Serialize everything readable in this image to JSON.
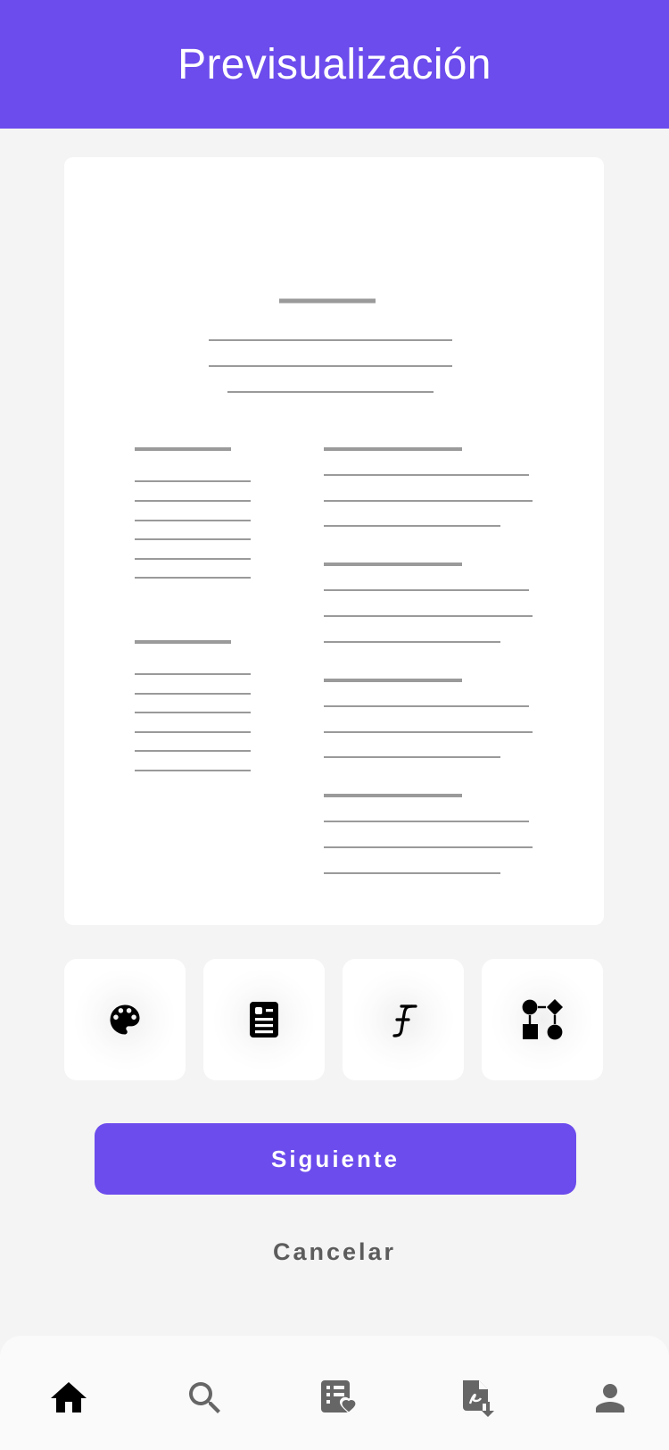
{
  "header": {
    "title": "Previsualización"
  },
  "toolbar": {
    "items": [
      {
        "icon": "palette-icon",
        "label": ""
      },
      {
        "icon": "resume-layout-icon",
        "label": ""
      },
      {
        "icon": "font-icon",
        "label": ""
      },
      {
        "icon": "shapes-icon",
        "label": ""
      }
    ]
  },
  "actions": {
    "next_label": "Siguiente",
    "cancel_label": "Cancelar"
  },
  "bottom_nav": {
    "items": [
      {
        "icon": "home-icon",
        "active": true
      },
      {
        "icon": "search-icon",
        "active": false
      },
      {
        "icon": "favorites-list-icon",
        "active": false
      },
      {
        "icon": "pdf-download-icon",
        "active": false
      },
      {
        "icon": "profile-icon",
        "active": false
      }
    ]
  },
  "colors": {
    "primary": "#6c4cec",
    "background": "#f4f4f4",
    "inactive_icon": "#666666",
    "active_icon": "#000000"
  }
}
